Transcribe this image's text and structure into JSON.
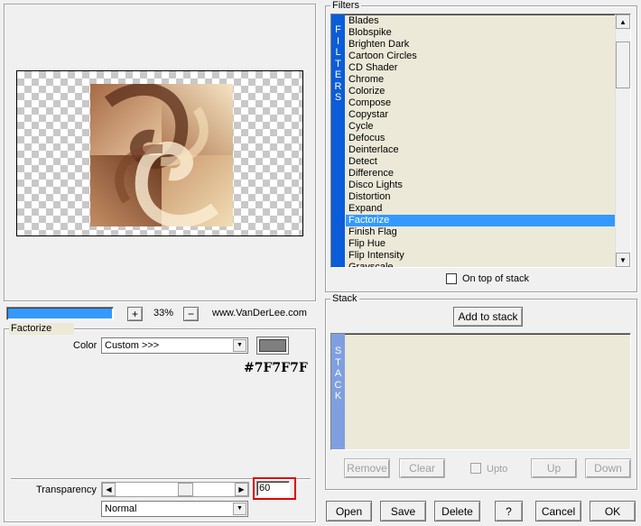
{
  "preview": {
    "zoom": "33%",
    "zoom_in": "+",
    "zoom_out": "−",
    "website": "www.VanDerLee.com",
    "progress": 1.0
  },
  "factorize": {
    "group_title": "Factorize",
    "color_label": "Color",
    "color_value": "Custom >>>",
    "swatch_color": "#7f7f7f",
    "hex_text": "#7F7F7F",
    "transparency_label": "Transparency",
    "transparency_value": "60",
    "transparency_fraction": 0.6,
    "blend_mode": "Normal"
  },
  "filters": {
    "group_title": "Filters",
    "vertical_label": [
      "F",
      "I",
      "L",
      "T",
      "E",
      "R",
      "S"
    ],
    "items": [
      "Blades",
      "Blobspike",
      "Brighten Dark",
      "Cartoon Circles",
      "CD Shader",
      "Chrome",
      "Colorize",
      "Compose",
      "Copystar",
      "Cycle",
      "Defocus",
      "Deinterlace",
      "Detect",
      "Difference",
      "Disco Lights",
      "Distortion",
      "Expand",
      "Factorize",
      "Finish Flag",
      "Flip Hue",
      "Flip Intensity",
      "Grayscale"
    ],
    "selected": "Factorize",
    "on_top_label": "On top of stack"
  },
  "stack": {
    "group_title": "Stack",
    "add_label": "Add to stack",
    "vertical_label": [
      "S",
      "T",
      "A",
      "C",
      "K"
    ],
    "remove_label": "Remove",
    "clear_label": "Clear",
    "upto_label": "Upto",
    "up_label": "Up",
    "down_label": "Down"
  },
  "footer": {
    "open": "Open",
    "save": "Save",
    "delete": "Delete",
    "help": "?",
    "cancel": "Cancel",
    "ok": "OK"
  },
  "colors": {
    "accent": "#0a5cd8",
    "selection": "#3399ff",
    "list_bg": "#ece9d8",
    "highlight_box": "#e00000"
  }
}
